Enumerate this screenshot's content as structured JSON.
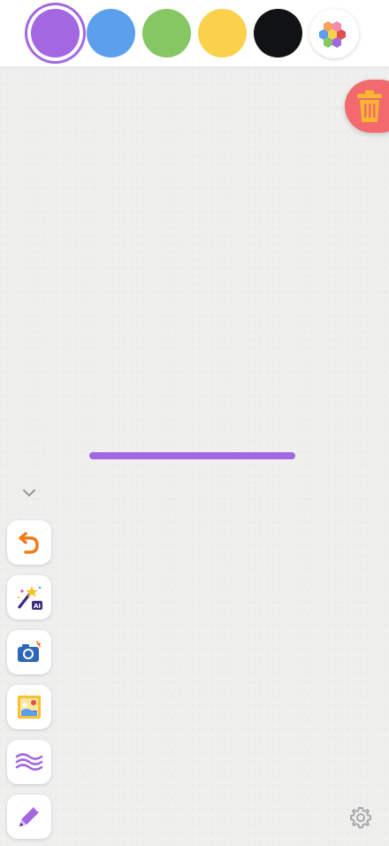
{
  "colors": {
    "swatches": [
      {
        "name": "purple",
        "hex": "#a267e1",
        "selected": true
      },
      {
        "name": "blue",
        "hex": "#5aa0ec",
        "selected": false
      },
      {
        "name": "green",
        "hex": "#86c763",
        "selected": false
      },
      {
        "name": "yellow",
        "hex": "#fbd14b",
        "selected": false
      },
      {
        "name": "black",
        "hex": "#111213",
        "selected": false
      }
    ],
    "palette_icon": "hexagon-palette-icon",
    "stroke": "#a267e1",
    "trash_bg": "#f26a6d",
    "canvas_bg": "#efefee"
  },
  "toolbar": {
    "items": [
      {
        "name": "undo",
        "icon": "undo-arrow-icon"
      },
      {
        "name": "ai-magic",
        "icon": "magic-wand-ai-icon",
        "badge": "AI"
      },
      {
        "name": "camera",
        "icon": "camera-icon"
      },
      {
        "name": "image",
        "icon": "picture-icon"
      },
      {
        "name": "wave-texture",
        "icon": "wave-lines-icon"
      },
      {
        "name": "pen",
        "icon": "pen-icon"
      }
    ],
    "collapse_icon": "chevron-down-icon"
  },
  "settings_icon": "gear-icon",
  "trash_icon": "trash-icon"
}
